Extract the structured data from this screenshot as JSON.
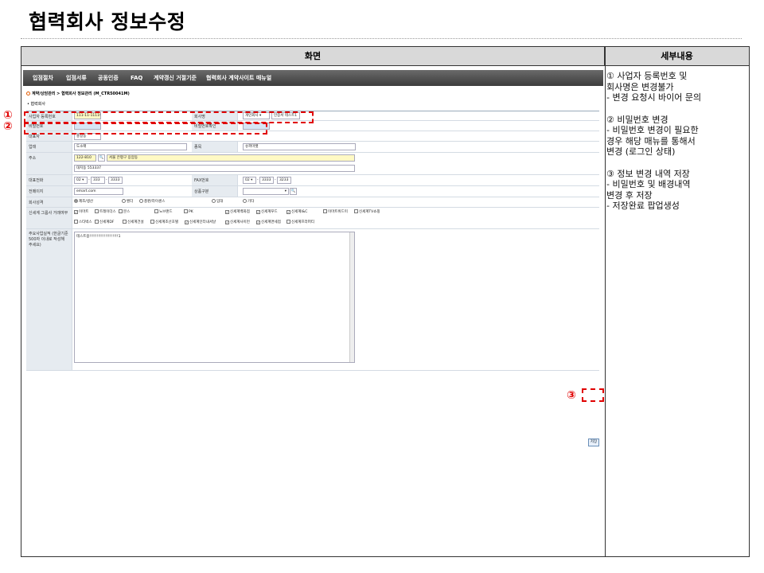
{
  "page_title": "협력회사 정보수정",
  "columns": {
    "left": "화면",
    "right": "세부내용"
  },
  "nav": [
    "입점절차",
    "입점서류",
    "공동인증",
    "FAQ",
    "계약갱신 거절기준",
    "협력회사 계약사이트 매뉴얼"
  ],
  "breadcrumb": "계약/상담관리 > 협력회사 정보관리 (M_CTR50041M)",
  "section_title": "• 협력회사",
  "form": {
    "biz_no_label": "사업자 등록번호",
    "biz_no_value": "111-11-11119",
    "company_name_label": "회사명",
    "company_type_value": "개인회사",
    "company_name_value": "인증서 테스트1",
    "password_label": "비밀번호",
    "password_confirm_label": "비밀번호확인",
    "ceo_label": "대표자",
    "ceo_value": "홍길동",
    "business_type_label": "업태",
    "business_type_value": "도소매",
    "business_item_label": "종목",
    "business_item_value": "슈퍼마켓",
    "address_label": "주소",
    "zip_value": "122-810",
    "address_value": "서울 은평구 응암동",
    "address_detail_value": "대지동 553337",
    "phone_label": "대표전화",
    "phone_area": "02",
    "phone_mid": "333",
    "phone_last": "3333",
    "fax_label": "FAX번호",
    "fax_area": "02",
    "fax_mid": "3333",
    "fax_last": "3233",
    "email_label": "전메이지",
    "email_value": "emart.com",
    "category_label": "상품구분",
    "corp_type_label": "회사성격",
    "corp_types": [
      "제조/생산",
      "벤더",
      "총판/라이센스",
      "임대",
      "기타"
    ],
    "stores_label": "신세계 그룹사 거래여부",
    "stores_row1": [
      "이마트",
      "트레이더스",
      "분스",
      "노브랜드",
      "PK",
      "신세계백화점",
      "신세계푸드",
      "신세계I&C",
      "이마트위드미",
      "신세계TV쇼핑"
    ],
    "stores_row2": [
      "스타벅스",
      "신세계DF",
      "신세계건설",
      "신세계조선호텔",
      "신세계인터내셔날",
      "신세계사이먼",
      "신세계면세점",
      "신세계프라퍼티"
    ],
    "intro_label": "주요사업실적 (한글기준 500자 이내로 작성해 주세요)",
    "intro_value": "테스트용!!!!!!!!!!!!!!!!!!!!1",
    "save_label": "저장"
  },
  "markers": [
    "①",
    "②",
    "③"
  ],
  "notes": [
    {
      "lines": [
        "① 사업자 등록번호 및",
        "    회사명은 변경불가",
        "  - 변경 요청시 바이어 문의"
      ]
    },
    {
      "lines": [
        "② 비밀번호 변경",
        "  - 비밀번호 변경이 필요한",
        "    경우 해당 매뉴를 통해서",
        "    변경 (로그인 상태)"
      ]
    },
    {
      "lines": [
        "③ 정보 변경 내역 저장",
        "  - 비밀번호 및 배경내역",
        "    변경 후 저장",
        "  - 저장완료 팝업생성"
      ]
    }
  ],
  "colors": {
    "highlight": "#e00000",
    "header_bg": "#d9d9d9",
    "nav_bg": "#4a4a4a",
    "label_bg": "#e6ebf0"
  }
}
